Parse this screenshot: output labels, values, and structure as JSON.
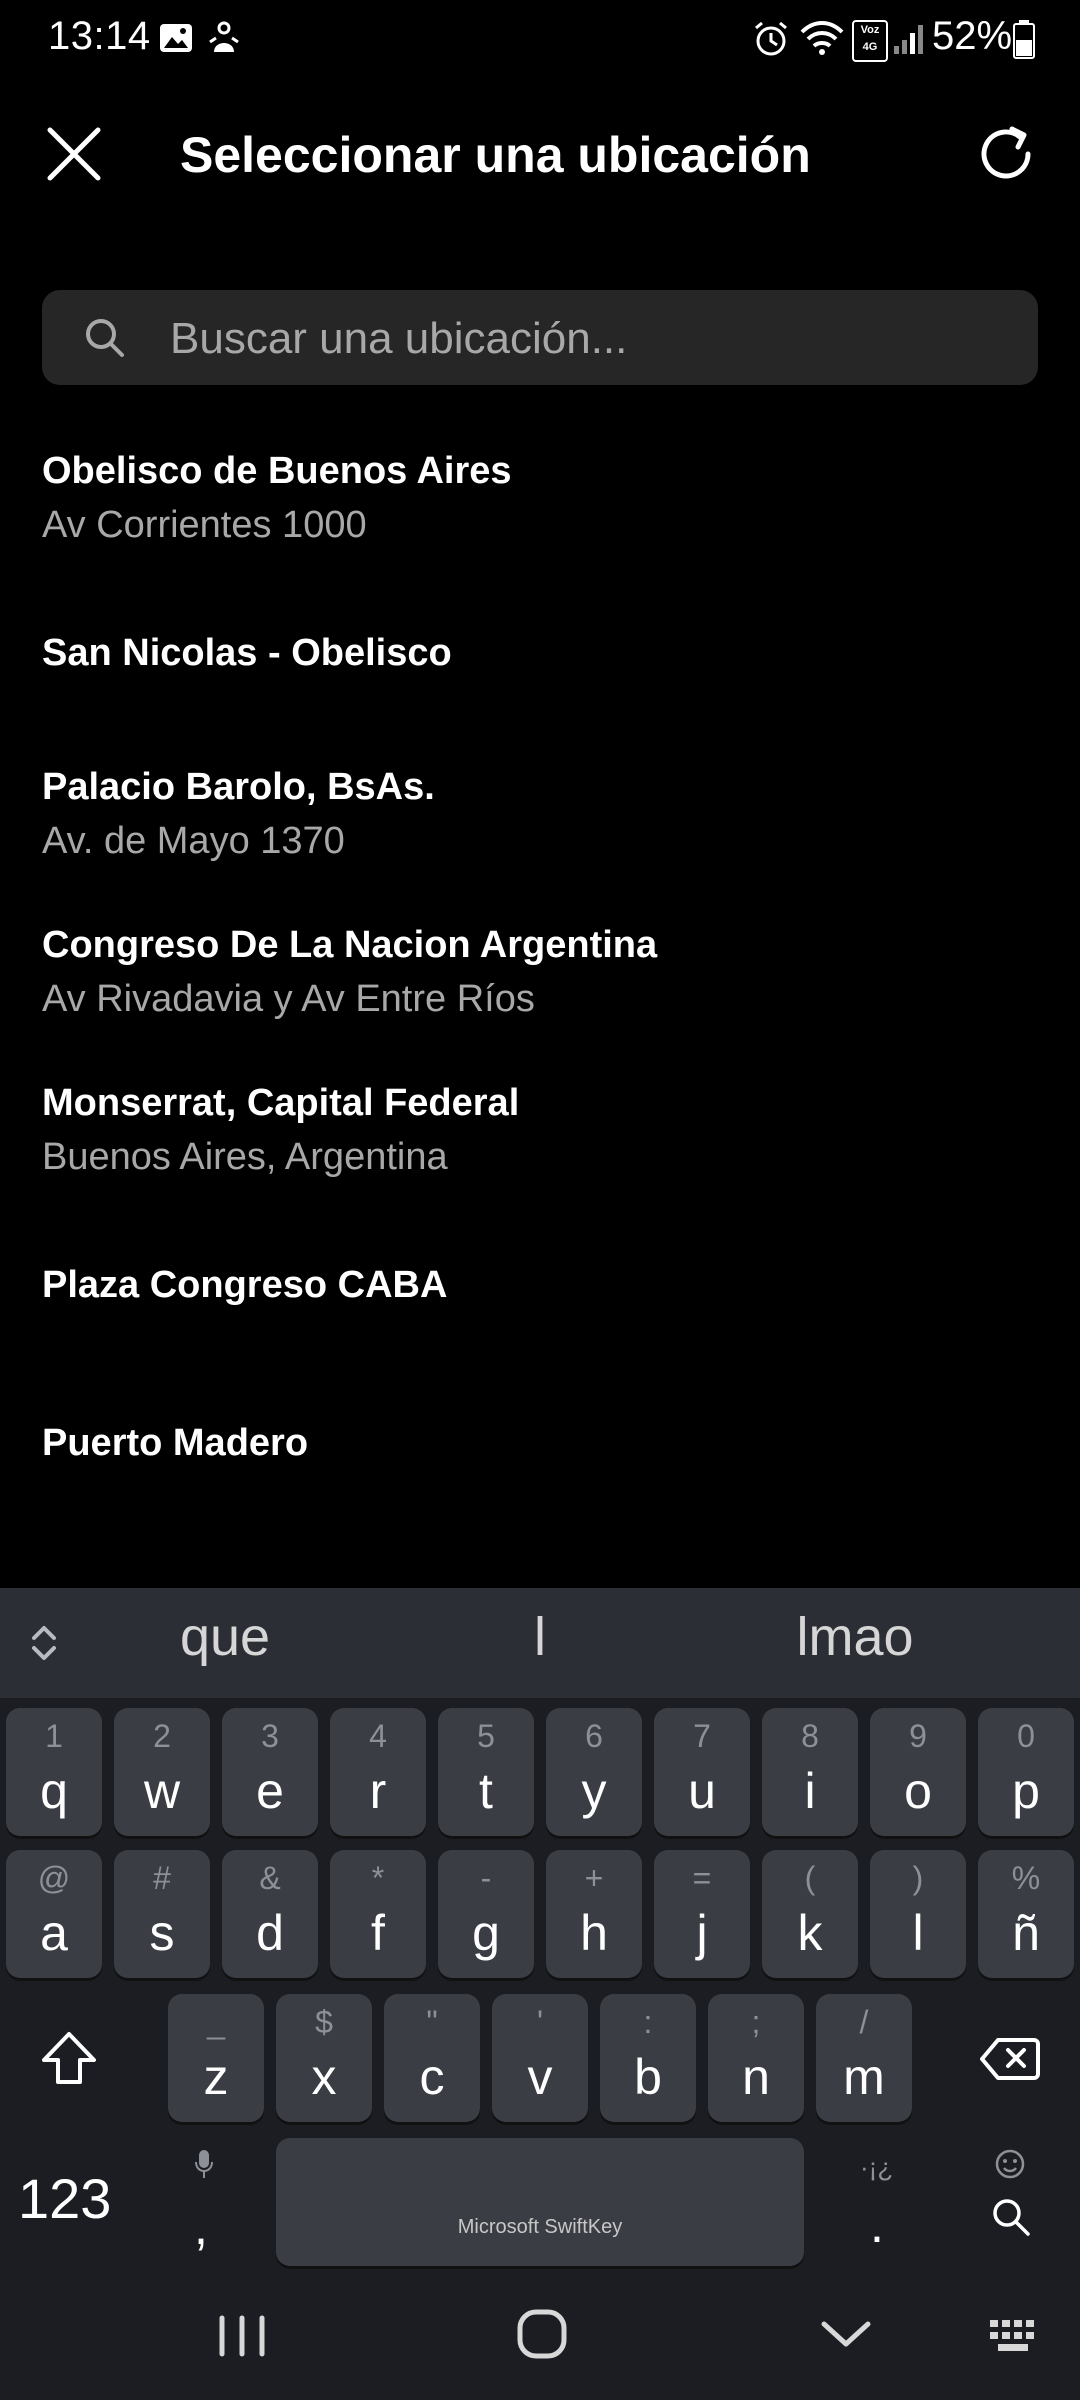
{
  "status_bar": {
    "time": "13:14",
    "battery": "52%",
    "left_icons": [
      "gallery-icon",
      "notification-icon"
    ],
    "right_icons": [
      "alarm-icon",
      "wifi-icon",
      "volte-icon",
      "signal-icon",
      "battery-icon"
    ],
    "volte_text": "Voz 4G"
  },
  "header": {
    "title": "Seleccionar una ubicación"
  },
  "search": {
    "placeholder": "Buscar una ubicación..."
  },
  "results": [
    {
      "title": "Obelisco de Buenos Aires",
      "subtitle": "Av Corrientes 1000"
    },
    {
      "title": "San Nicolas - Obelisco",
      "subtitle": ""
    },
    {
      "title": "Palacio Barolo, BsAs.",
      "subtitle": "Av. de Mayo 1370"
    },
    {
      "title": "Congreso De La Nacion Argentina",
      "subtitle": "Av Rivadavia y Av Entre Ríos"
    },
    {
      "title": "Monserrat, Capital Federal",
      "subtitle": "Buenos Aires, Argentina"
    },
    {
      "title": "Plaza Congreso CABA",
      "subtitle": ""
    },
    {
      "title": "Puerto Madero",
      "subtitle": ""
    }
  ],
  "keyboard": {
    "suggestions": [
      "que",
      "l",
      "lmao"
    ],
    "row1": [
      {
        "hint": "1",
        "key": "q"
      },
      {
        "hint": "2",
        "key": "w"
      },
      {
        "hint": "3",
        "key": "e"
      },
      {
        "hint": "4",
        "key": "r"
      },
      {
        "hint": "5",
        "key": "t"
      },
      {
        "hint": "6",
        "key": "y"
      },
      {
        "hint": "7",
        "key": "u"
      },
      {
        "hint": "8",
        "key": "i"
      },
      {
        "hint": "9",
        "key": "o"
      },
      {
        "hint": "0",
        "key": "p"
      }
    ],
    "row2": [
      {
        "hint": "@",
        "key": "a"
      },
      {
        "hint": "#",
        "key": "s"
      },
      {
        "hint": "&",
        "key": "d"
      },
      {
        "hint": "*",
        "key": "f"
      },
      {
        "hint": "-",
        "key": "g"
      },
      {
        "hint": "+",
        "key": "h"
      },
      {
        "hint": "=",
        "key": "j"
      },
      {
        "hint": "(",
        "key": "k"
      },
      {
        "hint": ")",
        "key": "l"
      },
      {
        "hint": "%",
        "key": "ñ"
      }
    ],
    "row3": [
      {
        "hint": "_",
        "key": "z"
      },
      {
        "hint": "$",
        "key": "x"
      },
      {
        "hint": "\"",
        "key": "c"
      },
      {
        "hint": "'",
        "key": "v"
      },
      {
        "hint": ":",
        "key": "b"
      },
      {
        "hint": ";",
        "key": "n"
      },
      {
        "hint": "/",
        "key": "m"
      }
    ],
    "numbers_key": "123",
    "comma_key": ",",
    "period_key": ".",
    "period_hint": "·¡¿",
    "space_label": "Microsoft SwiftKey"
  }
}
